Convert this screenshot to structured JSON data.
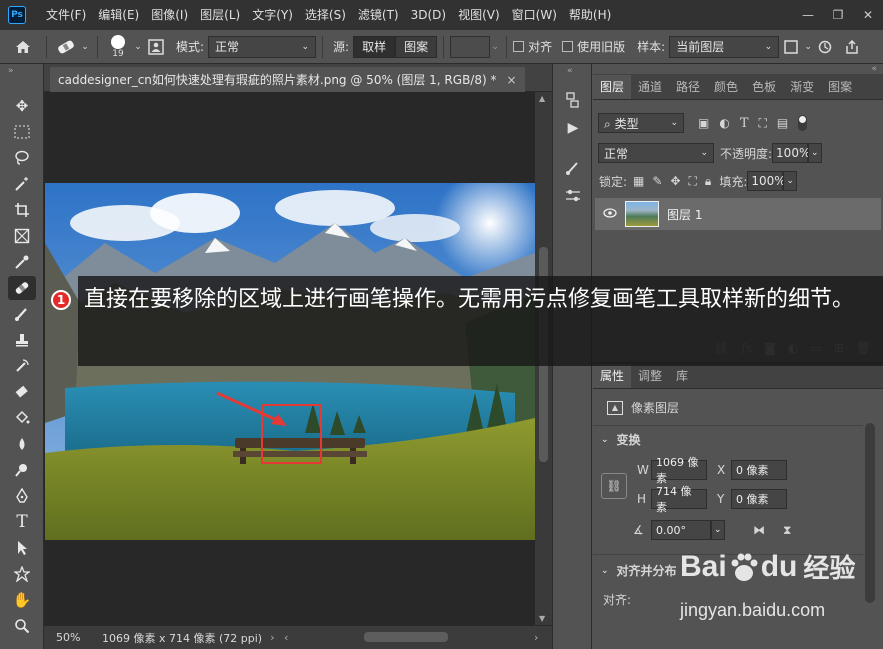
{
  "app": {
    "logo": "Ps"
  },
  "menu": [
    "文件(F)",
    "编辑(E)",
    "图像(I)",
    "图层(L)",
    "文字(Y)",
    "选择(S)",
    "滤镜(T)",
    "3D(D)",
    "视图(V)",
    "窗口(W)",
    "帮助(H)"
  ],
  "window_controls": [
    "—",
    "❐",
    "✕"
  ],
  "options": {
    "brush_size": "19",
    "mode_label": "模式:",
    "mode_value": "正常",
    "source_label": "源:",
    "sample_btn": "取样",
    "pattern_btn": "图案",
    "align_label": "对齐",
    "legacy_label": "使用旧版",
    "sample_label": "样本:",
    "sample_value": "当前图层"
  },
  "document": {
    "tab_title": "caddesigner_cn如何快速处理有瑕疵的照片素材.png @ 50% (图层 1, RGB/8) *",
    "tab_close": "×",
    "zoom": "50%",
    "doc_info": "1069 像素 x 714 像素 (72 ppi)"
  },
  "layers_panel": {
    "tabs": [
      "图层",
      "通道",
      "路径",
      "颜色",
      "色板",
      "渐变",
      "图案"
    ],
    "filter_value": "类型",
    "blend_value": "正常",
    "opacity_label": "不透明度:",
    "opacity_value": "100%",
    "lock_label": "锁定:",
    "fill_label": "填充:",
    "fill_value": "100%",
    "layer_name": "图层 1"
  },
  "props_panel": {
    "tabs": [
      "属性",
      "调整",
      "库"
    ],
    "kind": "像素图层",
    "transform_title": "变换",
    "w_label": "W",
    "w_value": "1069 像素",
    "h_label": "H",
    "h_value": "714 像素",
    "x_label": "X",
    "x_value": "0 像素",
    "y_label": "Y",
    "y_value": "0 像素",
    "angle_value": "0.00°",
    "align_title": "对齐并分布",
    "align_label": "对齐:"
  },
  "annotation": {
    "badge": "1",
    "text": "直接在要移除的区域上进行画笔操作。无需用污点修复画笔工具取样新的细节。"
  },
  "watermark": {
    "brand_a": "Bai",
    "brand_b": "du",
    "brand_cn": "经验",
    "url": "jingyan.baidu.com"
  },
  "colors": {
    "highlight_box": "#e53935",
    "arrow": "#e53935"
  }
}
